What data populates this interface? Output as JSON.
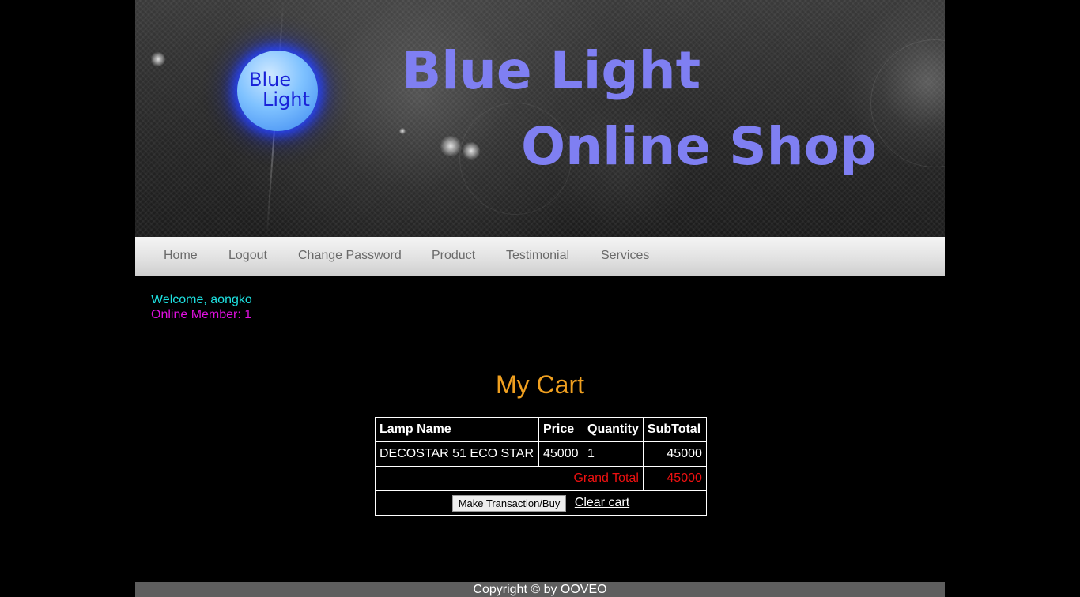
{
  "header": {
    "logo_line1": "Blue",
    "logo_line2": "Light",
    "title_line1": "Blue Light",
    "title_line2": "Online Shop"
  },
  "nav": {
    "items": [
      "Home",
      "Logout",
      "Change Password",
      "Product",
      "Testimonial",
      "Services"
    ]
  },
  "user": {
    "welcome": "Welcome, aongko",
    "online_members": "Online Member: 1"
  },
  "cart": {
    "title": "My Cart",
    "columns": [
      "Lamp Name",
      "Price",
      "Quantity",
      "SubTotal"
    ],
    "rows": [
      {
        "name": "DECOSTAR 51 ECO STAR",
        "price": "45000",
        "quantity": "1",
        "subtotal": "45000"
      }
    ],
    "grand_total_label": "Grand Total",
    "grand_total_value": "45000",
    "buy_button": "Make Transaction/Buy",
    "clear_link": "Clear cart"
  },
  "footer": {
    "copyright": "Copyright © by OOVEO"
  },
  "colors": {
    "title": "#7f7ff2",
    "welcome": "#1ee0e0",
    "online": "#e010e0",
    "cart_title": "#f0a020",
    "grand_total": "#ee1111"
  }
}
